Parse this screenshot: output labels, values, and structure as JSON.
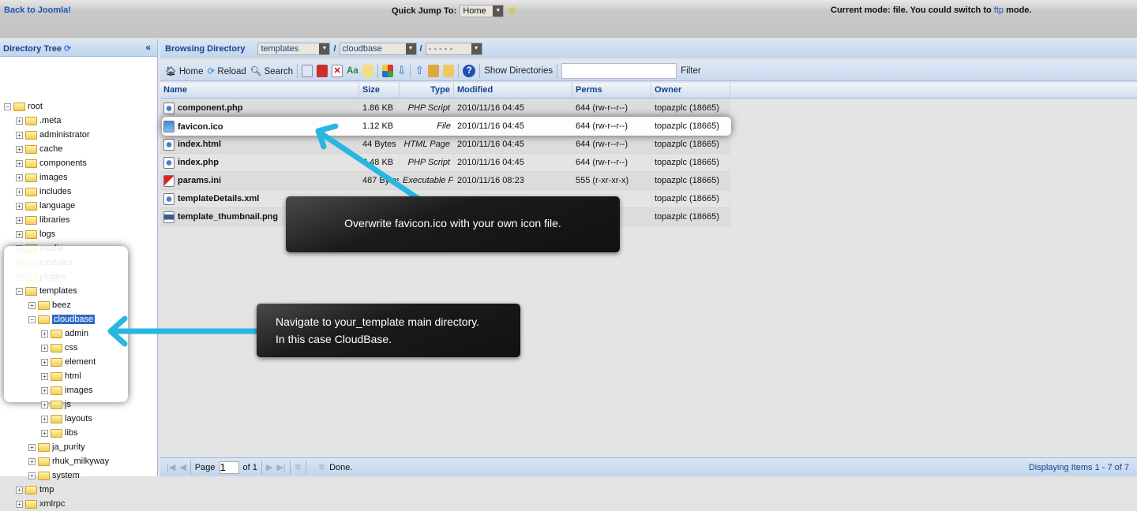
{
  "topbar": {
    "back_link": "Back to Joomla!",
    "quick_jump_label": "Quick Jump To:",
    "quick_jump_value": "Home",
    "mode_text": "Current mode: file. You could switch to",
    "mode_link": "ftp",
    "mode_suffix": "mode."
  },
  "tree": {
    "title": "Directory Tree",
    "collapse": "«",
    "nodes": [
      {
        "label": "root",
        "depth": 0,
        "expanded": true
      },
      {
        "label": ".meta",
        "depth": 1
      },
      {
        "label": "administrator",
        "depth": 1
      },
      {
        "label": "cache",
        "depth": 1
      },
      {
        "label": "components",
        "depth": 1
      },
      {
        "label": "images",
        "depth": 1
      },
      {
        "label": "includes",
        "depth": 1
      },
      {
        "label": "language",
        "depth": 1
      },
      {
        "label": "libraries",
        "depth": 1
      },
      {
        "label": "logs",
        "depth": 1
      },
      {
        "label": "media",
        "depth": 1
      },
      {
        "label": "modules",
        "depth": 1
      },
      {
        "label": "plugins",
        "depth": 1
      },
      {
        "label": "templates",
        "depth": 1,
        "expanded": true
      },
      {
        "label": "beez",
        "depth": 2
      },
      {
        "label": "cloudbase",
        "depth": 2,
        "expanded": true,
        "selected": true
      },
      {
        "label": "admin",
        "depth": 3
      },
      {
        "label": "css",
        "depth": 3
      },
      {
        "label": "element",
        "depth": 3
      },
      {
        "label": "html",
        "depth": 3
      },
      {
        "label": "images",
        "depth": 3
      },
      {
        "label": "js",
        "depth": 3
      },
      {
        "label": "layouts",
        "depth": 3
      },
      {
        "label": "libs",
        "depth": 3
      },
      {
        "label": "ja_purity",
        "depth": 2
      },
      {
        "label": "rhuk_milkyway",
        "depth": 2
      },
      {
        "label": "system",
        "depth": 2
      },
      {
        "label": "tmp",
        "depth": 1
      },
      {
        "label": "xmlrpc",
        "depth": 1
      }
    ]
  },
  "browse": {
    "label": "Browsing Directory",
    "sel1": "templates",
    "sel2": "cloudbase",
    "sel3": "- - - - -"
  },
  "toolbar": {
    "home": "Home",
    "reload": "Reload",
    "search": "Search",
    "show_dirs": "Show Directories",
    "filter_value": "",
    "filter_label": "Filter"
  },
  "columns": [
    "Name",
    "Size",
    "Type",
    "Modified",
    "Perms",
    "Owner"
  ],
  "files": [
    {
      "name": "component.php",
      "size": "1.86 KB",
      "type": "PHP Script",
      "modified": "2010/11/16 04:45",
      "perms": "644 (rw-r--r--)",
      "owner": "topazplc (18665)",
      "icon": "php-file-icon"
    },
    {
      "name": "favicon.ico",
      "size": "1.12 KB",
      "type": "File",
      "modified": "2010/11/16 04:45",
      "perms": "644 (rw-r--r--)",
      "owner": "topazplc (18665)",
      "icon": "ico-file-icon"
    },
    {
      "name": "index.html",
      "size": "44 Bytes",
      "type": "HTML Page",
      "modified": "2010/11/16 04:45",
      "perms": "644 (rw-r--r--)",
      "owner": "topazplc (18665)",
      "icon": "html-file-icon"
    },
    {
      "name": "index.php",
      "size": "2.48 KB",
      "type": "PHP Script",
      "modified": "2010/11/16 04:45",
      "perms": "644 (rw-r--r--)",
      "owner": "topazplc (18665)",
      "icon": "php-file-icon"
    },
    {
      "name": "params.ini",
      "size": "487 Bytes",
      "type": "Executable F",
      "modified": "2010/11/16 08:23",
      "perms": "555 (r-xr-xr-x)",
      "owner": "topazplc (18665)",
      "icon": "ini-file-icon"
    },
    {
      "name": "templateDetails.xml",
      "size": "",
      "type": "",
      "modified": "",
      "perms": "",
      "owner": "topazplc (18665)",
      "icon": "xml-file-icon"
    },
    {
      "name": "template_thumbnail.png",
      "size": "",
      "type": "",
      "modified": "",
      "perms": "",
      "owner": "topazplc (18665)",
      "icon": "png-file-icon"
    }
  ],
  "footer": {
    "page_label": "Page",
    "page_value": "1",
    "of": "of 1",
    "status": "Done.",
    "displaying": "Displaying Items 1 - 7 of 7"
  },
  "callouts": {
    "file": "Overwrite favicon.ico with your own icon file.",
    "dir_line1": "Navigate to your_template main directory.",
    "dir_line2": "In this case CloudBase."
  },
  "colors": {
    "accent": "#15428b",
    "arrow": "#29b6e0",
    "selection": "#316ac5"
  }
}
